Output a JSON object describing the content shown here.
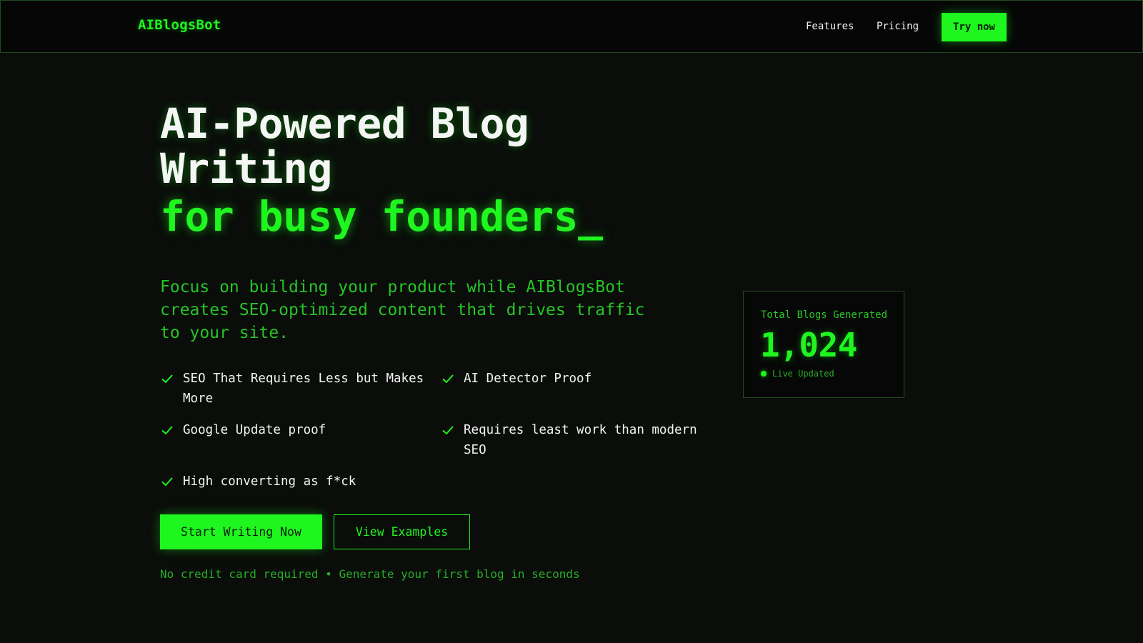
{
  "header": {
    "brand": "AIBlogsBot",
    "nav": [
      {
        "label": "Features"
      },
      {
        "label": "Pricing"
      }
    ],
    "cta_label": "Try now"
  },
  "hero": {
    "headline": "AI-Powered Blog Writing",
    "headline_accent": "for busy founders_",
    "subtext": "Focus on building your product while AIBlogsBot creates SEO-optimized content that drives traffic to your site.",
    "features": [
      {
        "label": "SEO That Requires Less but Makes More",
        "icon": "check-icon"
      },
      {
        "label": "AI Detector Proof",
        "icon": "check-icon"
      },
      {
        "label": "Google Update proof",
        "icon": "check-icon"
      },
      {
        "label": "Requires least work than modern SEO",
        "icon": "check-icon"
      },
      {
        "label": "High converting as f*ck",
        "icon": "check-icon"
      }
    ],
    "primary_button": "Start Writing Now",
    "secondary_button": "View Examples",
    "footnote": "No credit card required • Generate your first blog in seconds"
  },
  "stats": {
    "label": "Total Blogs Generated",
    "value": "1,024",
    "status": "Live Updated"
  },
  "colors": {
    "accent": "#1ff51f",
    "background": "#0a0d0a",
    "muted_green": "#27c427"
  }
}
